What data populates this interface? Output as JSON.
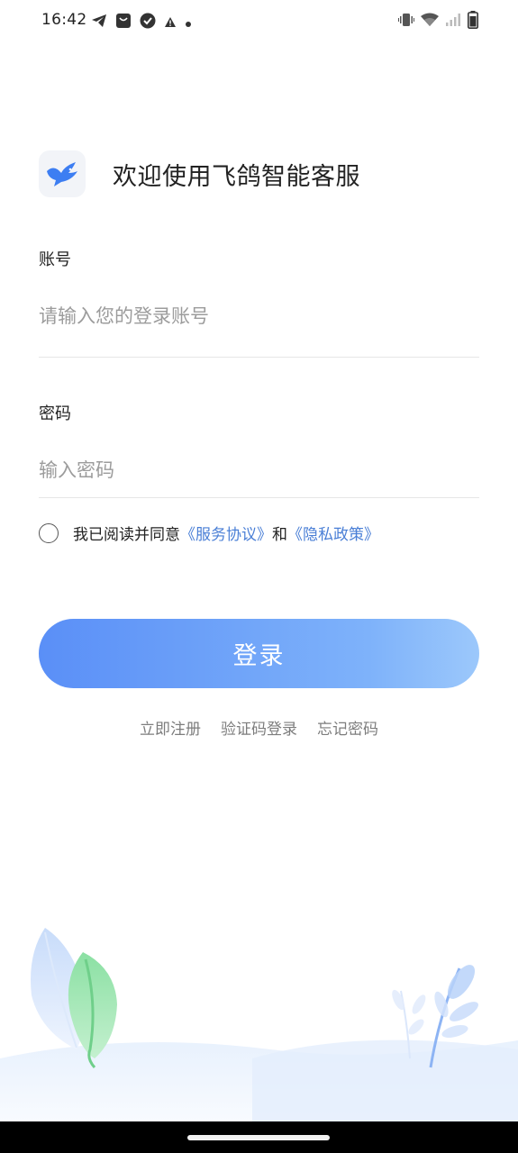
{
  "status_bar": {
    "time": "16:42",
    "left_icons": [
      "telegram-icon",
      "shopping-bag-icon",
      "check-circle-icon",
      "warning-icon",
      "dot-icon"
    ],
    "right_icons": [
      "vibrate-icon",
      "wifi-icon",
      "signal-icon",
      "battery-icon"
    ]
  },
  "header": {
    "logo_icon": "pigeon-icon",
    "title": "欢迎使用飞鸽智能客服"
  },
  "account": {
    "label": "账号",
    "placeholder": "请输入您的登录账号",
    "value": ""
  },
  "password": {
    "label": "密码",
    "placeholder": "输入密码",
    "value": ""
  },
  "agreement": {
    "checked": false,
    "prefix": "我已阅读并同意",
    "terms_link": "《服务协议》",
    "conjunction": "和",
    "privacy_link": "《隐私政策》"
  },
  "login_button": {
    "label": "登录"
  },
  "links": {
    "register": "立即注册",
    "sms_login": "验证码登录",
    "forgot_password": "忘记密码"
  },
  "colors": {
    "accent": "#5a8ff7",
    "accent_light": "#9cc8fb",
    "link": "#4a7fd6",
    "placeholder": "#9c9c9c"
  }
}
